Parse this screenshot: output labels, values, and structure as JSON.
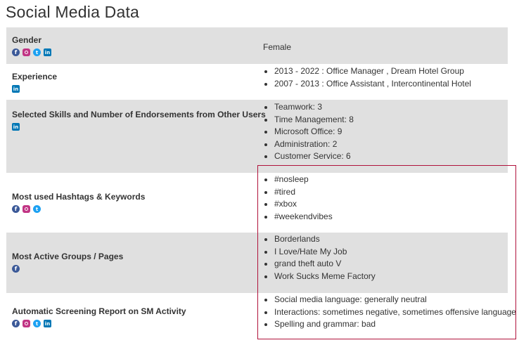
{
  "page_title": "Social Media Data",
  "rows": {
    "gender": {
      "label": "Gender",
      "icons": [
        "facebook-icon",
        "instagram-icon",
        "twitter-icon",
        "linkedin-icon"
      ],
      "value": "Female"
    },
    "experience": {
      "label": "Experience",
      "icons": [
        "linkedin-icon"
      ],
      "items": [
        "2013 - 2022 : Office Manager , Dream Hotel Group",
        "2007 - 2013 : Office Assistant , Intercontinental Hotel"
      ]
    },
    "skills": {
      "label": "Selected Skills and Number of Endorsements from Other Users",
      "icons": [
        "linkedin-icon"
      ],
      "items": [
        "Teamwork: 3",
        "Time Management: 8",
        "Microsoft Office: 9",
        "Administration: 2",
        "Customer Service: 6"
      ]
    },
    "hashtags": {
      "label": "Most used Hashtags & Keywords",
      "icons": [
        "facebook-icon",
        "instagram-icon",
        "twitter-icon"
      ],
      "items": [
        "#nosleep",
        "#tired",
        "#xbox",
        "#weekendvibes"
      ]
    },
    "groups": {
      "label": "Most Active Groups / Pages",
      "icons": [
        "facebook-icon"
      ],
      "items": [
        "Borderlands",
        "I Love/Hate My Job",
        "grand theft auto V",
        "Work Sucks Meme Factory"
      ]
    },
    "screening": {
      "label": "Automatic Screening Report on SM Activity",
      "icons": [
        "facebook-icon",
        "instagram-icon",
        "twitter-icon",
        "linkedin-icon"
      ],
      "items": [
        "Social media language: generally neutral",
        "Interactions: sometimes negative, sometimes offensive language",
        "Spelling and grammar: bad"
      ]
    }
  },
  "colors": {
    "shaded_row": "#e0e0e0",
    "highlight_border": "#b0123b",
    "facebook": "#3b5998",
    "instagram": "#c13584",
    "twitter": "#1da1f2",
    "linkedin": "#0077b5"
  }
}
